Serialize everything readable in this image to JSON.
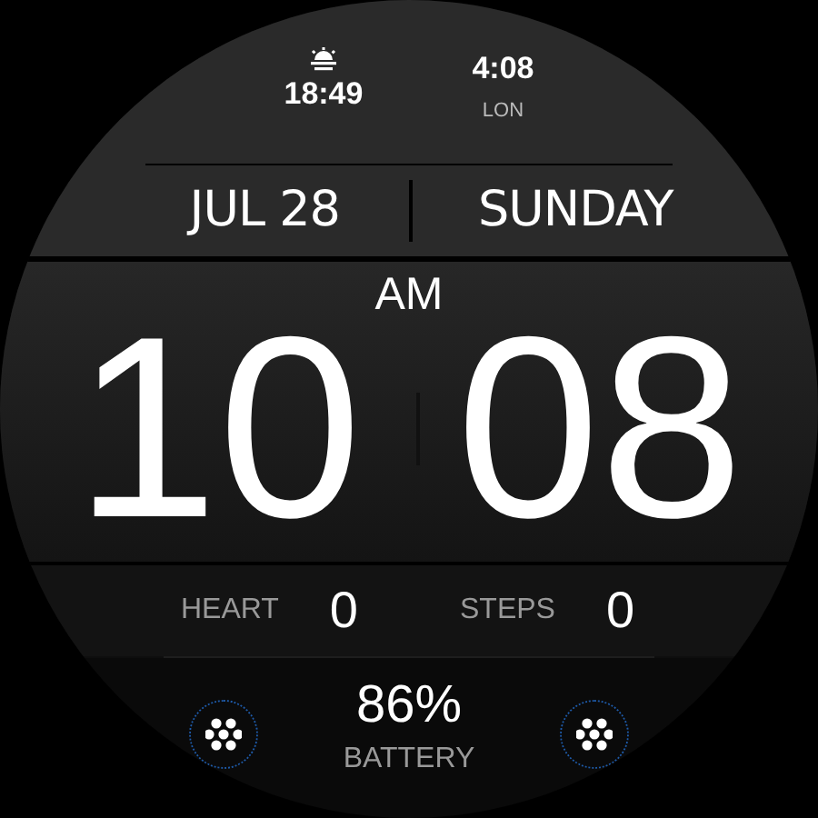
{
  "top": {
    "sunrise_time": "18:49",
    "world_clock": {
      "time": "4:08",
      "city": "LON"
    }
  },
  "date": {
    "month_day": "JUL 28",
    "weekday": "SUNDAY"
  },
  "time": {
    "ampm": "AM",
    "hours": "10",
    "minutes": "08"
  },
  "stats": [
    {
      "label": "HEART",
      "value": "0"
    },
    {
      "label": "STEPS",
      "value": "0"
    }
  ],
  "battery": {
    "value": "86%",
    "label": "BATTERY"
  }
}
